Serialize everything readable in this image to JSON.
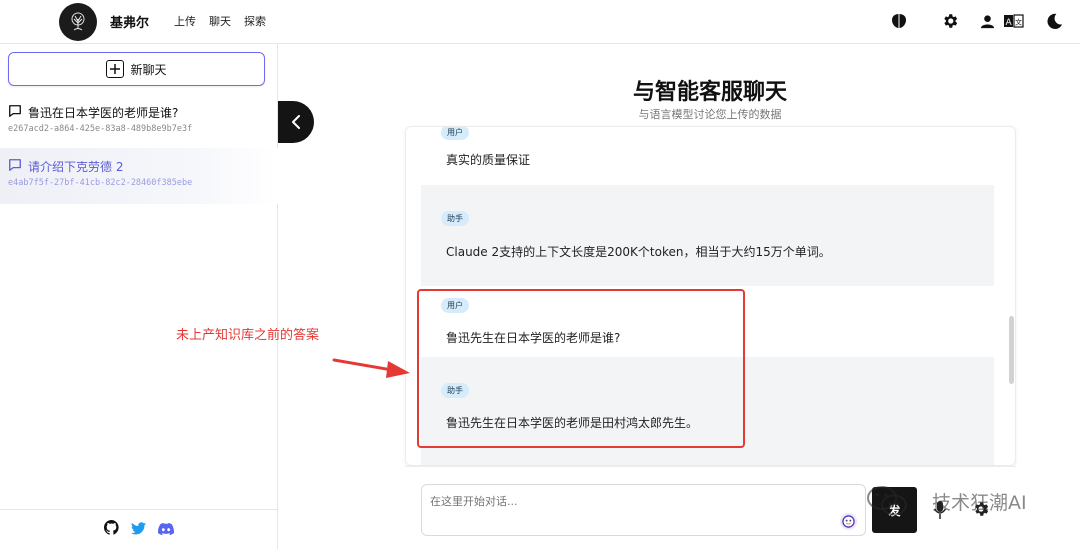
{
  "header": {
    "brand": "基弗尔",
    "nav": [
      "上传",
      "聊天",
      "探索"
    ],
    "icons": [
      "brain-icon",
      "gear-icon",
      "user-icon",
      "translate-icon",
      "moon-icon"
    ]
  },
  "sidebar": {
    "new_chat_label": "新聊天",
    "chats": [
      {
        "title": "鲁迅在日本学医的老师是谁?",
        "id": "e267acd2-a864-425e-83a8-489b8e9b7e3f",
        "active": false
      },
      {
        "title": "请介绍下克劳德 2",
        "id": "e4ab7f5f-27bf-41cb-82c2-28460f385ebe",
        "active": true
      }
    ],
    "footer_icons": [
      "github-icon",
      "twitter-icon",
      "discord-icon"
    ]
  },
  "main": {
    "title": "与智能客服聊天",
    "subtitle": "与语言模型讨论您上传的数据",
    "messages": [
      {
        "role": "用户",
        "text": "真实的质量保证"
      },
      {
        "role": "助手",
        "text": "Claude 2支持的上下文长度是200K个token，相当于大约15万个单词。"
      },
      {
        "role": "用户",
        "text": "鲁迅先生在日本学医的老师是谁?"
      },
      {
        "role": "助手",
        "text": "鲁迅先生在日本学医的老师是田村鸿太郎先生。"
      }
    ],
    "input_placeholder": "在这里开始对话...",
    "send_label": "发"
  },
  "annotation": {
    "text": "未上产知识库之前的答案",
    "color": "#e53935"
  },
  "watermark": {
    "text": "技术狂潮AI"
  },
  "colors": {
    "accent": "#6d6af5",
    "active_chat": "#5b5bd6",
    "badge_bg": "#d6ecfb",
    "assistant_bg": "#f3f4f6"
  }
}
